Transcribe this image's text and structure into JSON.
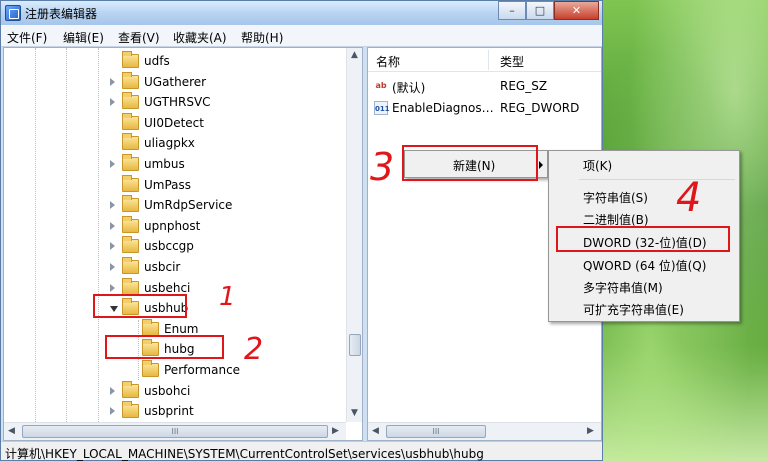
{
  "window": {
    "title": "注册表编辑器",
    "caption_buttons": {
      "minimize": "–",
      "maximize": "□",
      "close": "✕"
    }
  },
  "menubar": [
    "文件(F)",
    "编辑(E)",
    "查看(V)",
    "收藏夹(A)",
    "帮助(H)"
  ],
  "tree": [
    {
      "label": "udfs",
      "expander": "none",
      "level": 0
    },
    {
      "label": "UGatherer",
      "expander": "collapsed",
      "level": 0
    },
    {
      "label": "UGTHRSVC",
      "expander": "collapsed",
      "level": 0
    },
    {
      "label": "UI0Detect",
      "expander": "none",
      "level": 0
    },
    {
      "label": "uliagpkx",
      "expander": "none",
      "level": 0
    },
    {
      "label": "umbus",
      "expander": "collapsed",
      "level": 0
    },
    {
      "label": "UmPass",
      "expander": "none",
      "level": 0
    },
    {
      "label": "UmRdpService",
      "expander": "collapsed",
      "level": 0
    },
    {
      "label": "upnphost",
      "expander": "collapsed",
      "level": 0
    },
    {
      "label": "usbccgp",
      "expander": "collapsed",
      "level": 0
    },
    {
      "label": "usbcir",
      "expander": "collapsed",
      "level": 0
    },
    {
      "label": "usbehci",
      "expander": "collapsed",
      "level": 0
    },
    {
      "label": "usbhub",
      "expander": "expanded",
      "level": 0
    },
    {
      "label": "Enum",
      "expander": "none",
      "level": 1
    },
    {
      "label": "hubg",
      "expander": "none",
      "level": 1
    },
    {
      "label": "Performance",
      "expander": "none",
      "level": 1
    },
    {
      "label": "usbohci",
      "expander": "collapsed",
      "level": 0
    },
    {
      "label": "usbprint",
      "expander": "collapsed",
      "level": 0
    }
  ],
  "list": {
    "headers": {
      "name": "名称",
      "type": "类型"
    },
    "rows": [
      {
        "icon": "string-value-icon",
        "glyph": "ab",
        "name": "(默认)",
        "type": "REG_SZ"
      },
      {
        "icon": "dword-value-icon",
        "glyph": "011",
        "name": "EnableDiagnos…",
        "type": "REG_DWORD"
      }
    ]
  },
  "context_menu": {
    "new_label": "新建(N)"
  },
  "submenu": {
    "key": "项(K)",
    "items": [
      "字符串值(S)",
      "二进制值(B)",
      "DWORD (32-位)值(D)",
      "QWORD (64 位)值(Q)",
      "多字符串值(M)",
      "可扩充字符串值(E)"
    ]
  },
  "statusbar": "计算机\\HKEY_LOCAL_MACHINE\\SYSTEM\\CurrentControlSet\\services\\usbhub\\hubg",
  "annotations": [
    "1",
    "2",
    "3",
    "4"
  ],
  "scroll_glyphs": {
    "up": "▲",
    "down": "▼",
    "left": "◀",
    "right": "▶",
    "grip": "III"
  },
  "colors": {
    "annotation_red": "#e0161b",
    "titlebar": "#b9d4f1",
    "folder": "#e8b841"
  }
}
